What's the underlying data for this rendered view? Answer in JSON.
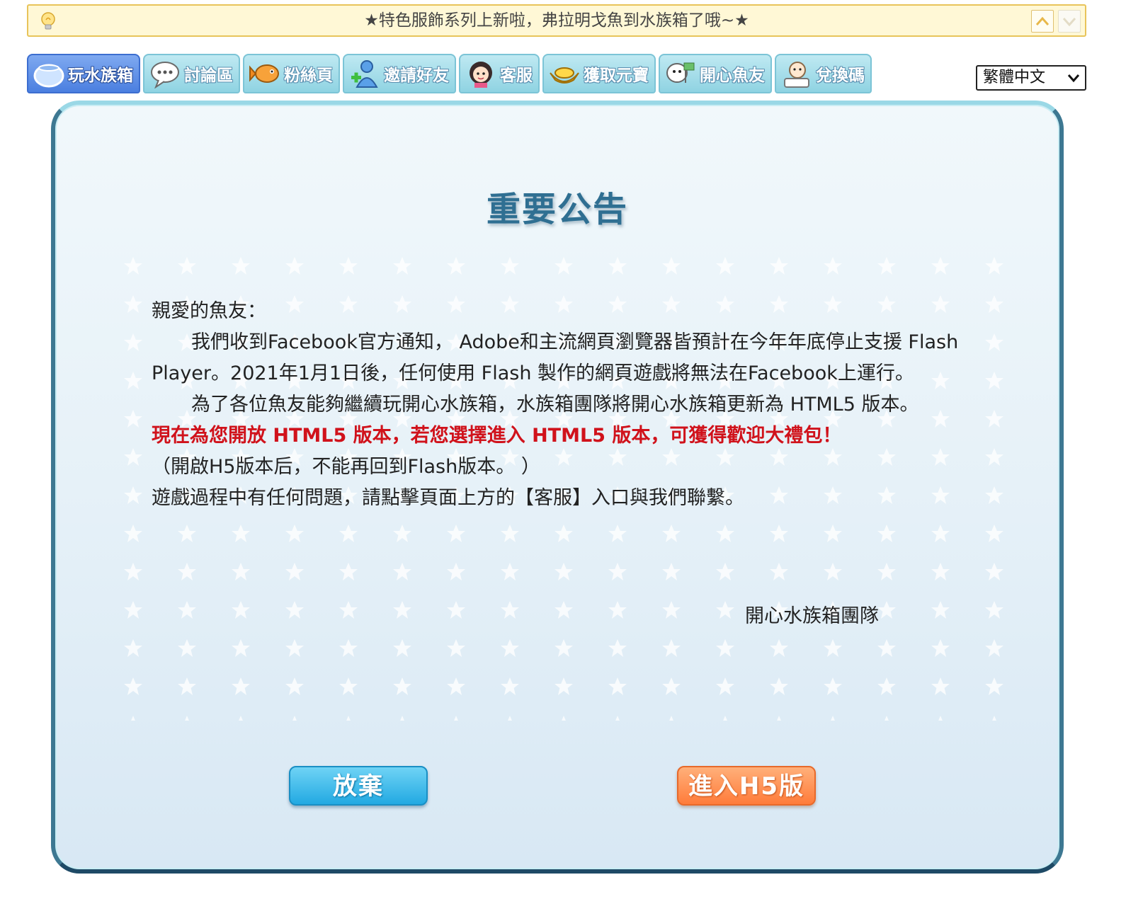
{
  "notice": {
    "text": "★特色服飾系列上新啦，弗拉明戈魚到水族箱了哦~★"
  },
  "tabs": [
    {
      "label": "玩水族箱",
      "icon": "fishbowl-icon",
      "active": true
    },
    {
      "label": "討論區",
      "icon": "chat-bubble-icon",
      "active": false
    },
    {
      "label": "粉絲頁",
      "icon": "fish-icon",
      "active": false
    },
    {
      "label": "邀請好友",
      "icon": "add-friend-icon",
      "active": false
    },
    {
      "label": "客服",
      "icon": "support-girl-icon",
      "active": false
    },
    {
      "label": "獲取元寶",
      "icon": "gold-ingot-icon",
      "active": false
    },
    {
      "label": "開心魚友",
      "icon": "fish-friends-icon",
      "active": false
    },
    {
      "label": "兌換碼",
      "icon": "redeem-code-icon",
      "active": false
    }
  ],
  "language": {
    "selected": "繁體中文"
  },
  "announcement": {
    "title": "重要公告",
    "greeting": "親愛的魚友：",
    "para1": "我們收到Facebook官方通知， Adobe和主流網頁瀏覽器皆預計在今年年底停止支援 Flash Player。2021年1月1日後，任何使用 Flash 製作的網頁遊戲將無法在Facebook上運行。",
    "para2": "為了各位魚友能夠繼續玩開心水族箱，水族箱團隊將開心水族箱更新為 HTML5 版本。",
    "highlight": "現在為您開放 HTML5 版本，若您選擇進入 HTML5 版本，可獲得歡迎大禮包！",
    "note": "（開啟H5版本后，不能再回到Flash版本。 ）",
    "contact": "遊戲過程中有任何問題，請點擊頁面上方的【客服】入口與我們聯繫。",
    "signature": "開心水族箱團隊"
  },
  "buttons": {
    "abandon": "放棄",
    "enter_h5": "進入H5版"
  },
  "colors": {
    "title": "#2f6f92",
    "highlight": "#d0121b",
    "abandon_button": "#22a9e2",
    "h5_button": "#ff7c3a",
    "active_tab": "#4b7fe0"
  }
}
